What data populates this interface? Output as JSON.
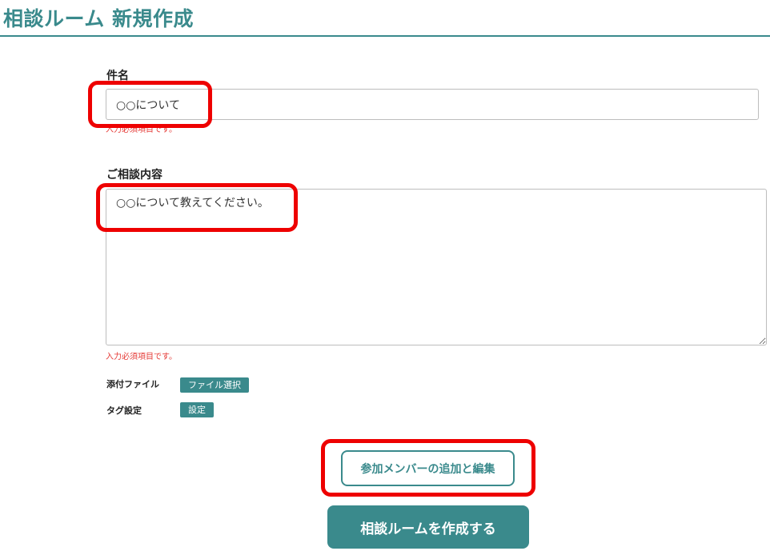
{
  "page": {
    "title": "相談ルーム 新規作成"
  },
  "subject": {
    "label": "件名",
    "value": "○○について",
    "error": "入力必須項目です。"
  },
  "consultation": {
    "label": "ご相談内容",
    "value": "○○について教えてください。",
    "error": "入力必須項目です。"
  },
  "attachment": {
    "label": "添付ファイル",
    "button": "ファイル選択"
  },
  "tags": {
    "label": "タグ設定",
    "button": "設定"
  },
  "actions": {
    "members_button": "参加メンバーの追加と編集",
    "create_button": "相談ルームを作成する"
  },
  "colors": {
    "accent": "#3a8a8c",
    "error": "#e53935",
    "highlight": "#ee0000"
  }
}
